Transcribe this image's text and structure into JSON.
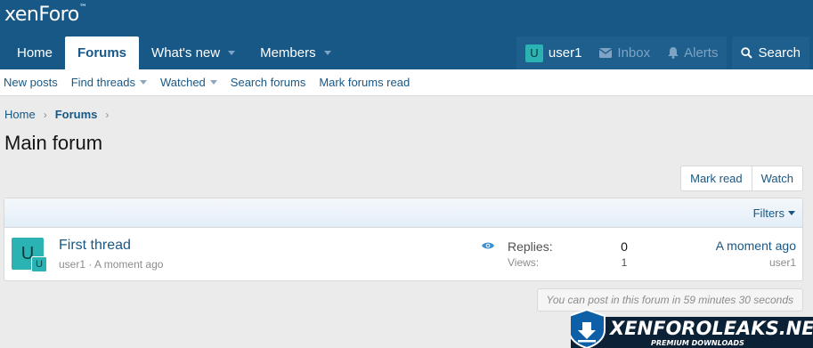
{
  "header": {
    "logo_text": "xenForo",
    "logo_tm": "™"
  },
  "nav": {
    "tabs": [
      {
        "label": "Home"
      },
      {
        "label": "Forums"
      },
      {
        "label": "What's new"
      },
      {
        "label": "Members"
      }
    ],
    "user": {
      "avatar_letter": "U",
      "name": "user1"
    },
    "inbox_label": "Inbox",
    "alerts_label": "Alerts",
    "search_label": "Search"
  },
  "subnav": {
    "items": [
      {
        "label": "New posts"
      },
      {
        "label": "Find threads"
      },
      {
        "label": "Watched"
      },
      {
        "label": "Search forums"
      },
      {
        "label": "Mark forums read"
      }
    ]
  },
  "breadcrumb": {
    "items": [
      "Home",
      "Forums"
    ]
  },
  "page": {
    "title": "Main forum"
  },
  "actions": {
    "mark_read": "Mark read",
    "watch": "Watch"
  },
  "filters_label": "Filters",
  "threads": [
    {
      "avatar_letter": "U",
      "badge_letter": "U",
      "title": "First thread",
      "author": "user1",
      "meta_sep": " · ",
      "started": "A moment ago",
      "replies_label": "Replies:",
      "replies": "0",
      "views_label": "Views:",
      "views": "1",
      "latest_time": "A moment ago",
      "latest_user": "user1"
    }
  ],
  "notice": "You can post in this forum in 59 minutes 30 seconds",
  "watermark": {
    "title": "XENFOROLEAKS.NET",
    "subtitle": "PREMIUM DOWNLOADS"
  },
  "colors": {
    "header_bg": "#185886",
    "link": "#185886",
    "avatar": "#2bb3b3",
    "page_bg": "#ebebeb"
  }
}
